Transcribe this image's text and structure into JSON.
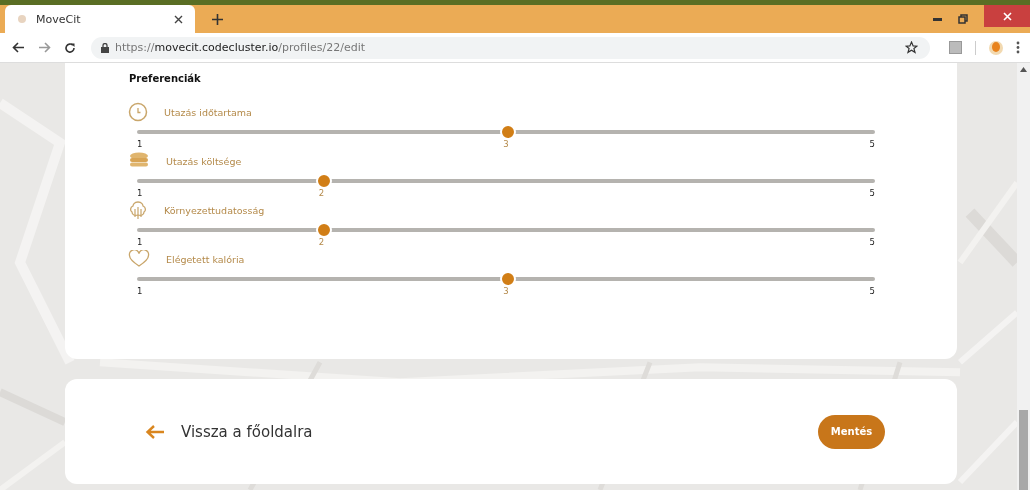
{
  "browser": {
    "tab": {
      "title": "MoveCit"
    },
    "url": {
      "scheme": "https://",
      "host": "movecit.codecluster.io",
      "path": "/profiles/22/edit"
    }
  },
  "section": {
    "title": "Preferenciák"
  },
  "preferences": [
    {
      "kind": "clock",
      "label": "Utazás időtartama",
      "level": 0.5,
      "min": "1",
      "value": "3",
      "max": "5"
    },
    {
      "kind": "coins",
      "label": "Utazás költsége",
      "level": 0.25,
      "min": "1",
      "value": "2",
      "max": "5"
    },
    {
      "kind": "tree",
      "label": "Környezettudatosság",
      "level": 0.25,
      "min": "1",
      "value": "2",
      "max": "5"
    },
    {
      "kind": "heart",
      "label": "Elégetett kalória",
      "level": 0.5,
      "min": "1",
      "value": "3",
      "max": "5"
    }
  ],
  "back_link": {
    "label": "Vissza a főoldalra"
  },
  "save_button": {
    "label": "Mentés"
  }
}
